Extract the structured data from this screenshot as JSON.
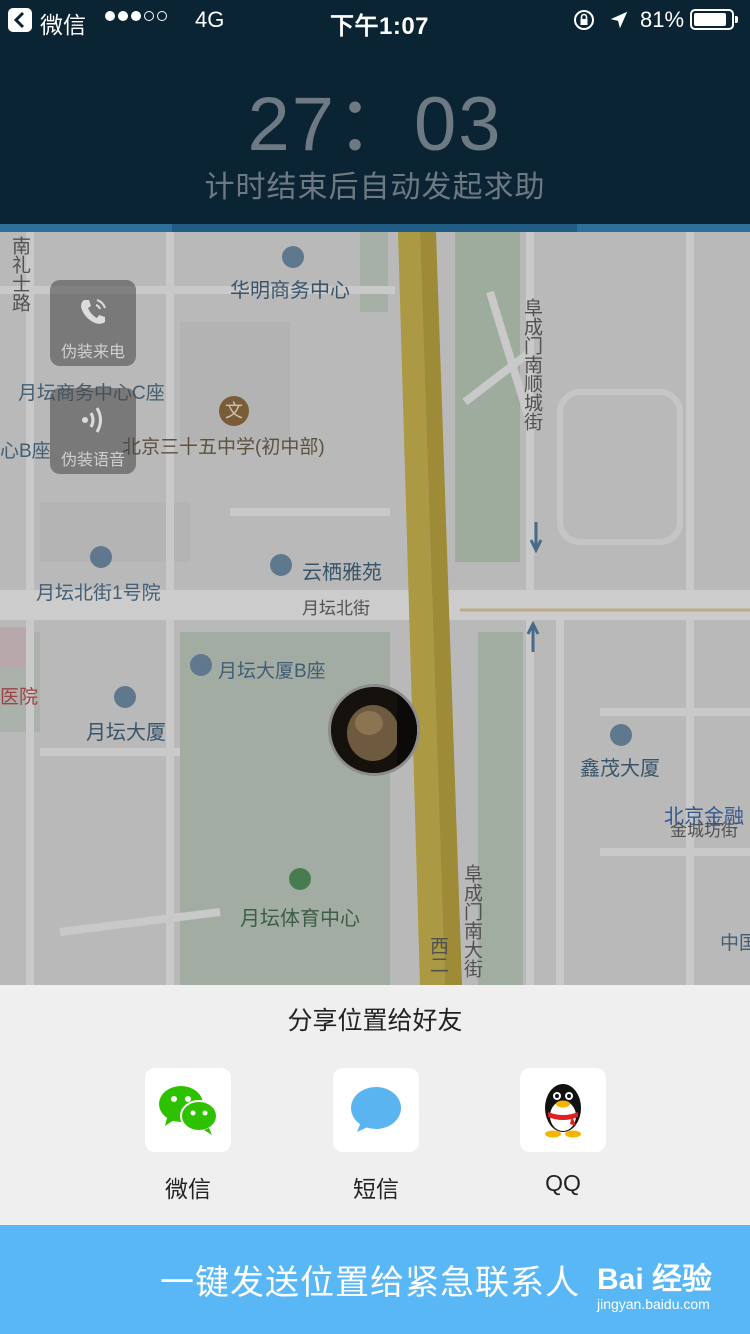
{
  "status_bar": {
    "app_name": "微信",
    "network": "4G",
    "time": "下午1:07",
    "battery": "81%",
    "battery_level": 0.81,
    "signal_dots": [
      true,
      true,
      true,
      false,
      false
    ]
  },
  "timer": {
    "countdown": "27：03",
    "subtitle": "计时结束后自动发起求助"
  },
  "map": {
    "labels": [
      "南礼士路",
      "华明商务中心",
      "阜成门南顺城街",
      "月坛商务中心C座",
      "心B座",
      "北京三十五中学(初中部)",
      "云栖雅苑",
      "月坛北街1号院",
      "月坛北街",
      "月坛大厦B座",
      "医院",
      "月坛大厦",
      "鑫茂大厦",
      "北京金融",
      "金城坊街",
      "月坛体育中心",
      "阜成门南大街",
      "西二",
      "中国"
    ],
    "buttons": {
      "fake_call": "伪装来电",
      "fake_voice": "伪装语音"
    }
  },
  "share": {
    "title": "分享位置给好友",
    "items": [
      {
        "label": "微信",
        "icon": "wechat-icon"
      },
      {
        "label": "短信",
        "icon": "sms-icon"
      },
      {
        "label": "QQ",
        "icon": "qq-icon"
      }
    ]
  },
  "action": {
    "send_label": "一键发送位置给紧急联系人"
  },
  "watermark": {
    "brand": "Bai 经验",
    "url": "jingyan.baidu.com"
  },
  "colors": {
    "timer_bg": "#0b2433",
    "accent": "#59b7f5",
    "share_bg": "#efefef"
  }
}
